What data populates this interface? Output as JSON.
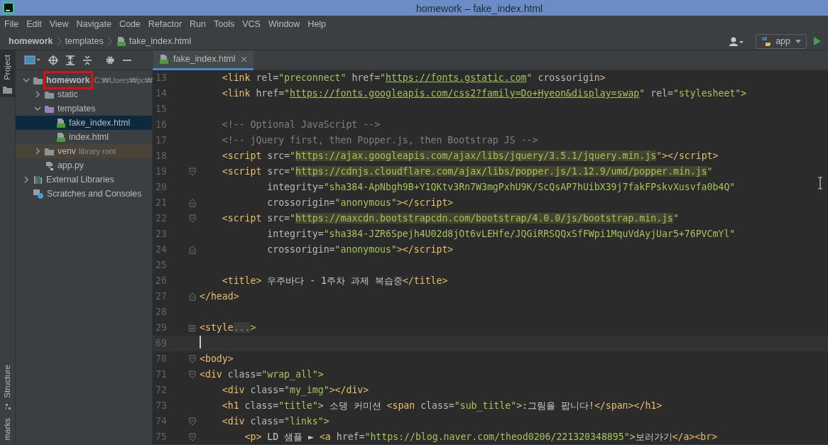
{
  "window": {
    "title": "homework – fake_index.html"
  },
  "menu": [
    "File",
    "Edit",
    "View",
    "Navigate",
    "Code",
    "Refactor",
    "Run",
    "Tools",
    "VCS",
    "Window",
    "Help"
  ],
  "breadcrumbs": [
    {
      "label": "homework",
      "kind": "project"
    },
    {
      "label": "templates",
      "kind": "folder"
    },
    {
      "label": "fake_index.html",
      "kind": "html"
    }
  ],
  "run_config": {
    "label": "app"
  },
  "side_tabs": [
    {
      "label": "Project",
      "kind": "folder",
      "selected": true
    },
    {
      "label": "Structure",
      "kind": "structure",
      "selected": false
    },
    {
      "label": "marks",
      "kind": "none",
      "selected": false
    }
  ],
  "project_tree": [
    {
      "label": "homework",
      "hint": "C:₩Users₩pc₩",
      "kind": "project",
      "expanded": true,
      "selected": false,
      "marked": true,
      "children": [
        {
          "label": "static",
          "kind": "folder",
          "expanded": false,
          "selected": false,
          "marked": false
        },
        {
          "label": "templates",
          "kind": "templates",
          "expanded": true,
          "selected": false,
          "marked": false,
          "children": [
            {
              "label": "fake_index.html",
              "kind": "html",
              "selected": true,
              "marked": false
            },
            {
              "label": "index.html",
              "kind": "html",
              "selected": false,
              "marked": false
            }
          ]
        },
        {
          "label": "venv",
          "hint": "library root",
          "kind": "library",
          "expanded": false,
          "selected": false,
          "marked": false
        },
        {
          "label": "app.py",
          "kind": "python",
          "selected": false,
          "marked": false
        }
      ]
    },
    {
      "label": "External Libraries",
      "kind": "libraries",
      "expanded": false,
      "selected": false,
      "marked": false
    },
    {
      "label": "Scratches and Consoles",
      "kind": "scratches",
      "selected": false,
      "marked": false
    }
  ],
  "editor_tabs": [
    {
      "label": "fake_index.html",
      "selected": true
    }
  ],
  "code_lines": [
    {
      "number": "13",
      "tokens": [
        {
          "kind": "tag",
          "text": "    <link"
        },
        {
          "kind": "attr",
          "text": " rel="
        },
        {
          "kind": "str",
          "text": "\"preconnect\""
        },
        {
          "kind": "attr",
          "text": " href="
        },
        {
          "kind": "str",
          "text": "\""
        },
        {
          "kind": "url",
          "text": "https://fonts.gstatic.com"
        },
        {
          "kind": "str",
          "text": "\""
        },
        {
          "kind": "attr",
          "text": " crossorigin"
        },
        {
          "kind": "tag",
          "text": ">"
        }
      ]
    },
    {
      "number": "14",
      "tokens": [
        {
          "kind": "tag",
          "text": "    <link"
        },
        {
          "kind": "attr",
          "text": " href="
        },
        {
          "kind": "str",
          "text": "\""
        },
        {
          "kind": "url",
          "text": "https://fonts.googleapis.com/css2?family=Do+Hyeon&display=swap"
        },
        {
          "kind": "str",
          "text": "\""
        },
        {
          "kind": "attr",
          "text": " rel="
        },
        {
          "kind": "str",
          "text": "\"stylesheet\""
        },
        {
          "kind": "tag",
          "text": ">"
        }
      ]
    },
    {
      "number": "15"
    },
    {
      "number": "16",
      "tokens": [
        {
          "kind": "comment",
          "text": "    <!-- Optional JavaScript -->"
        }
      ]
    },
    {
      "number": "17",
      "tokens": [
        {
          "kind": "comment",
          "text": "    <!-- jQuery first, then Popper.js, then Bootstrap JS -->"
        }
      ]
    },
    {
      "number": "18",
      "tokens": [
        {
          "kind": "tag",
          "text": "    <script"
        },
        {
          "kind": "attr",
          "text": " src="
        },
        {
          "kind": "str",
          "text": "\""
        },
        {
          "kind": "hl",
          "text": "https://ajax.googleapis.com/ajax/libs/jquery/3.5.1/jquery.min.js"
        },
        {
          "kind": "str",
          "text": "\""
        },
        {
          "kind": "tag",
          "text": "></script>"
        }
      ]
    },
    {
      "number": "19",
      "fold_start": true,
      "tokens": [
        {
          "kind": "tag",
          "text": "    <script"
        },
        {
          "kind": "attr",
          "text": " src="
        },
        {
          "kind": "str",
          "text": "\""
        },
        {
          "kind": "hl",
          "text": "https://cdnjs.cloudflare.com/ajax/libs/popper.js/1.12.9/umd/popper.min.js"
        },
        {
          "kind": "str",
          "text": "\""
        }
      ]
    },
    {
      "number": "20",
      "tokens": [
        {
          "kind": "attr",
          "text": "            integrity="
        },
        {
          "kind": "str",
          "text": "\"sha384-ApNbgh9B+Y1QKtv3Rn7W3mgPxhU9K/ScQsAP7hUibX39j7fakFPskvXusvfa0b4Q\""
        }
      ]
    },
    {
      "number": "21",
      "fold_end": true,
      "tokens": [
        {
          "kind": "attr",
          "text": "            crossorigin="
        },
        {
          "kind": "str",
          "text": "\"anonymous\""
        },
        {
          "kind": "tag",
          "text": "></script>"
        }
      ]
    },
    {
      "number": "22",
      "fold_start": true,
      "tokens": [
        {
          "kind": "tag",
          "text": "    <script"
        },
        {
          "kind": "attr",
          "text": " src="
        },
        {
          "kind": "str",
          "text": "\""
        },
        {
          "kind": "hl",
          "text": "https://maxcdn.bootstrapcdn.com/bootstrap/4.0.0/js/bootstrap.min.js"
        },
        {
          "kind": "str",
          "text": "\""
        }
      ]
    },
    {
      "number": "23",
      "tokens": [
        {
          "kind": "attr",
          "text": "            integrity="
        },
        {
          "kind": "str",
          "text": "\"sha384-JZR6Spejh4U02d8jOt6vLEHfe/JQGiRRSQQxSfFWpi1MquVdAyjUar5+76PVCmYl\""
        }
      ]
    },
    {
      "number": "24",
      "fold_end": true,
      "tokens": [
        {
          "kind": "attr",
          "text": "            crossorigin="
        },
        {
          "kind": "str",
          "text": "\"anonymous\""
        },
        {
          "kind": "tag",
          "text": "></script>"
        }
      ]
    },
    {
      "number": "25"
    },
    {
      "number": "26",
      "tokens": [
        {
          "kind": "tag",
          "text": "    <title>"
        },
        {
          "kind": "text",
          "text": " 우주바다 - 1주차 과제 복습중"
        },
        {
          "kind": "tag",
          "text": "</title>"
        }
      ]
    },
    {
      "number": "27",
      "fold_end": true,
      "tokens": [
        {
          "kind": "tag",
          "text": "</head>"
        }
      ]
    },
    {
      "number": "28"
    },
    {
      "number": "29",
      "collapsed": true,
      "tokens": [
        {
          "kind": "tag",
          "text": "<style"
        },
        {
          "kind": "dim",
          "text": "..."
        },
        {
          "kind": "tag",
          "text": ">"
        }
      ]
    },
    {
      "number": "69",
      "current": true
    },
    {
      "number": "70",
      "fold_start": true,
      "tokens": [
        {
          "kind": "tag",
          "text": "<body>"
        }
      ]
    },
    {
      "number": "71",
      "fold_start": true,
      "tokens": [
        {
          "kind": "tag",
          "text": "<div"
        },
        {
          "kind": "attr",
          "text": " class="
        },
        {
          "kind": "str",
          "text": "\"wrap_all\""
        },
        {
          "kind": "tag",
          "text": ">"
        }
      ]
    },
    {
      "number": "72",
      "tokens": [
        {
          "kind": "tag",
          "text": "    <div"
        },
        {
          "kind": "attr",
          "text": " class="
        },
        {
          "kind": "str",
          "text": "\"my_img\""
        },
        {
          "kind": "tag",
          "text": "></div>"
        }
      ]
    },
    {
      "number": "73",
      "tokens": [
        {
          "kind": "tag",
          "text": "    <h1"
        },
        {
          "kind": "attr",
          "text": " class="
        },
        {
          "kind": "str",
          "text": "\"title\""
        },
        {
          "kind": "tag",
          "text": ">"
        },
        {
          "kind": "text",
          "text": " 소댕 커미션 "
        },
        {
          "kind": "tag",
          "text": "<span"
        },
        {
          "kind": "attr",
          "text": " class="
        },
        {
          "kind": "str",
          "text": "\"sub_title\""
        },
        {
          "kind": "tag",
          "text": ">"
        },
        {
          "kind": "text",
          "text": ":그림을 팝니다!"
        },
        {
          "kind": "tag",
          "text": "</span></h1>"
        }
      ]
    },
    {
      "number": "74",
      "fold_start": true,
      "tokens": [
        {
          "kind": "tag",
          "text": "    <div"
        },
        {
          "kind": "attr",
          "text": " class="
        },
        {
          "kind": "str",
          "text": "\"links\""
        },
        {
          "kind": "tag",
          "text": ">"
        }
      ]
    },
    {
      "number": "75",
      "fold_start": true,
      "tokens": [
        {
          "kind": "tag",
          "text": "        <p>"
        },
        {
          "kind": "text",
          "text": " LD 샘플 ► "
        },
        {
          "kind": "tag",
          "text": "<a"
        },
        {
          "kind": "attr",
          "text": " href="
        },
        {
          "kind": "str",
          "text": "\"https://blog.naver.com/theod0206/221320348895\""
        },
        {
          "kind": "tag",
          "text": ">"
        },
        {
          "kind": "text",
          "text": "보러가기"
        },
        {
          "kind": "tag",
          "text": "</a><br>"
        }
      ]
    }
  ]
}
